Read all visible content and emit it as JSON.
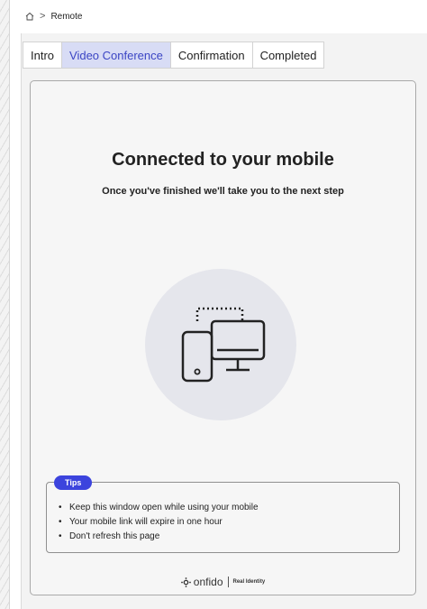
{
  "breadcrumb": {
    "home_icon": "home-icon",
    "separator": ">",
    "current": "Remote"
  },
  "tabs": [
    {
      "label": "Intro"
    },
    {
      "label": "Video Conference"
    },
    {
      "label": "Confirmation"
    },
    {
      "label": "Completed"
    }
  ],
  "active_tab": "Video Conference",
  "card": {
    "title": "Connected to your mobile",
    "subtitle": "Once you've finished we'll take you to the next step",
    "illustration_icon": "phone-desktop-icon"
  },
  "tips": {
    "badge": "Tips",
    "items": [
      "Keep this window open while using your mobile",
      "Your mobile link will expire in one hour",
      "Don't refresh this page"
    ]
  },
  "footer": {
    "brand": "onfido",
    "tagline": "Real Identity"
  },
  "colors": {
    "accent": "#3c44dd",
    "active_tab_bg": "#d8dcf5",
    "active_tab_text": "#3b45c4",
    "card_bg": "#f6f6f6",
    "illustration_bg": "#e5e6ec"
  }
}
